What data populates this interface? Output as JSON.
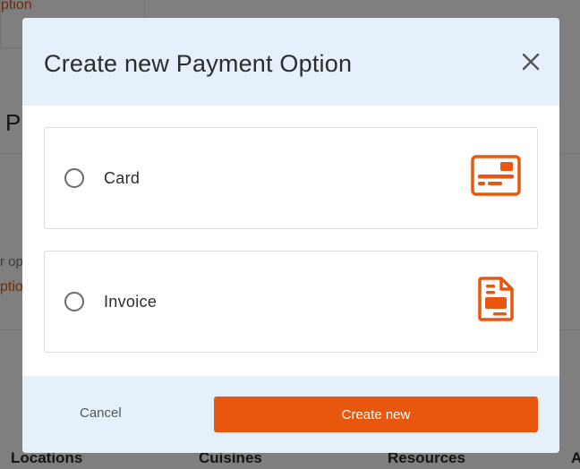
{
  "background": {
    "top_link": "ption",
    "heading": "P",
    "muted_text": "r op",
    "mid_link": "ption",
    "footer_links": [
      "Locations",
      "Cuisines",
      "Resources",
      "A"
    ]
  },
  "modal": {
    "title": "Create new Payment Option",
    "close_icon": "close-icon",
    "options": [
      {
        "label": "Card",
        "icon": "credit-card-icon",
        "selected": false
      },
      {
        "label": "Invoice",
        "icon": "invoice-document-icon",
        "selected": false
      }
    ],
    "footer": {
      "cancel_label": "Cancel",
      "create_label": "Create new"
    }
  },
  "colors": {
    "accent": "#e8570d",
    "header_bg": "#e5f0fb",
    "overlay": "rgba(0,0,0,0.5)"
  }
}
